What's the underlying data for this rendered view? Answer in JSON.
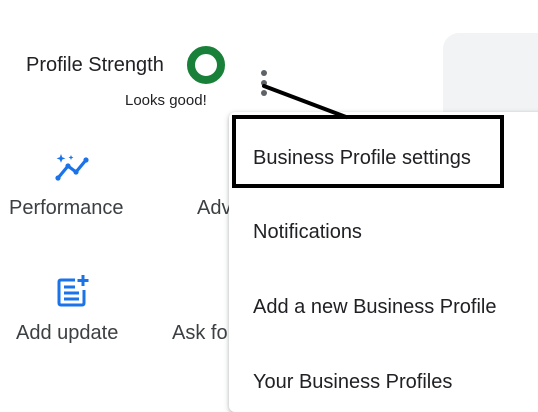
{
  "profile_strength": {
    "label": "Profile Strength",
    "status": "Looks good!",
    "ring_color": "#188038"
  },
  "actions": {
    "performance": {
      "label": "Performance",
      "icon": "trending-sparkle-icon"
    },
    "advertise": {
      "label": "Adv",
      "icon": ""
    },
    "add_update": {
      "label": "Add update",
      "icon": "post-add-icon"
    },
    "ask_for_reviews": {
      "label": "Ask fo",
      "icon": ""
    }
  },
  "more_menu": {
    "icon": "more-vert-icon",
    "items": [
      {
        "label": "Business Profile settings",
        "highlighted": true
      },
      {
        "label": "Notifications"
      },
      {
        "label": "Add a new Business Profile"
      },
      {
        "label": "Your Business Profiles"
      }
    ]
  },
  "colors": {
    "accent_blue": "#1a73e8",
    "highlight_border": "#000000"
  }
}
